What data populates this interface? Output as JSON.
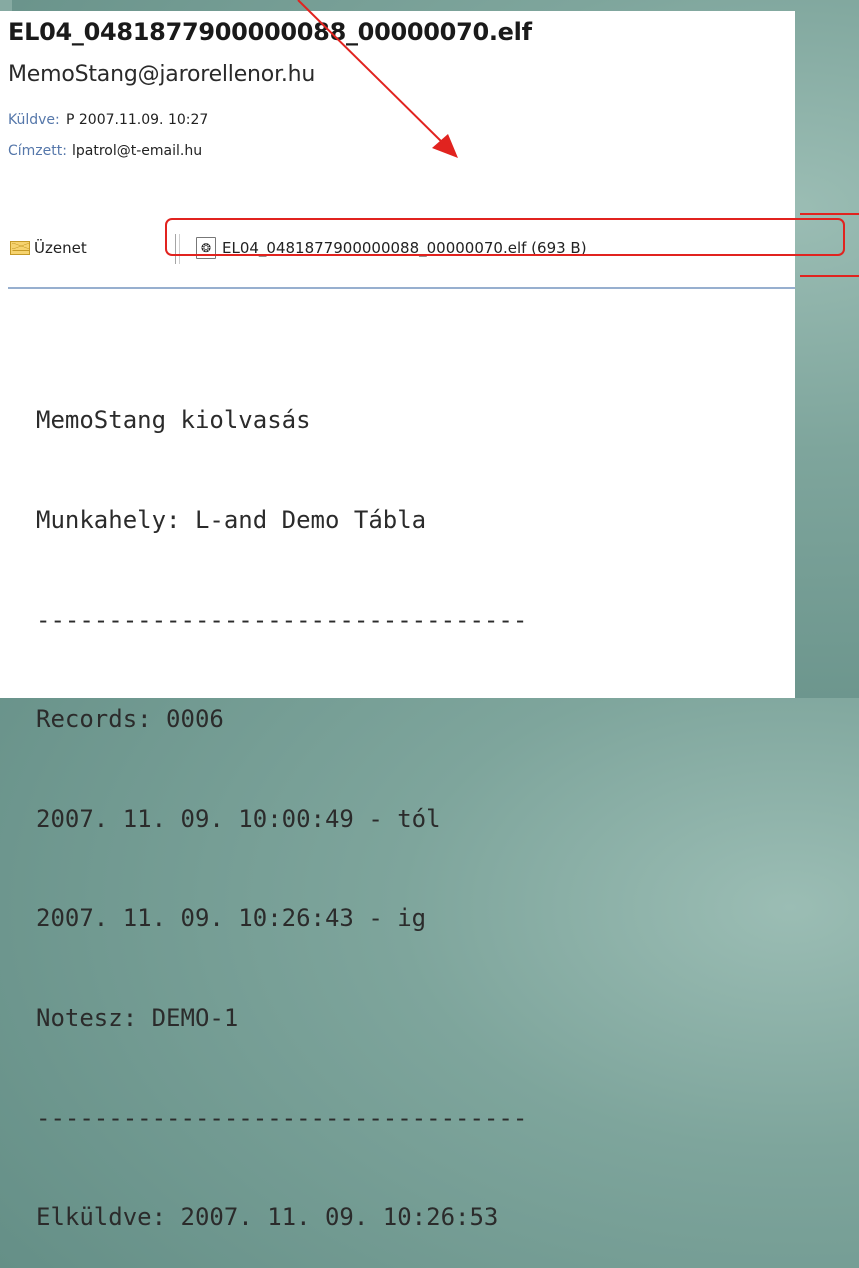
{
  "email": {
    "subject": "EL04_0481877900000088_00000070.elf",
    "sender": "MemoStang@jarorellenor.hu",
    "sent_label": "Küldve:",
    "sent_value": "P 2007.11.09. 10:27",
    "to_label": "Címzett:",
    "to_value": "lpatrol@t-email.hu"
  },
  "toolbar": {
    "message_tab_label": "Üzenet",
    "attachment_label": "EL04_0481877900000088_00000070.elf (693 B)"
  },
  "body": {
    "lines": [
      "MemoStang kiolvasás",
      "Munkahely: L-and Demo Tábla",
      "----------------------------------",
      "Records: 0006",
      "2007. 11. 09. 10:00:49 - tól",
      "2007. 11. 09. 10:26:43 - ig",
      "Notesz: DEMO-1",
      "----------------------------------",
      "Elküldve: 2007. 11. 09. 10:26:53"
    ]
  },
  "colors": {
    "annotation": "#e1231f",
    "header_label": "#5577aa",
    "background": "#7ea59c"
  },
  "icons": {
    "message": "envelope-icon",
    "attachment": "file-icon"
  }
}
